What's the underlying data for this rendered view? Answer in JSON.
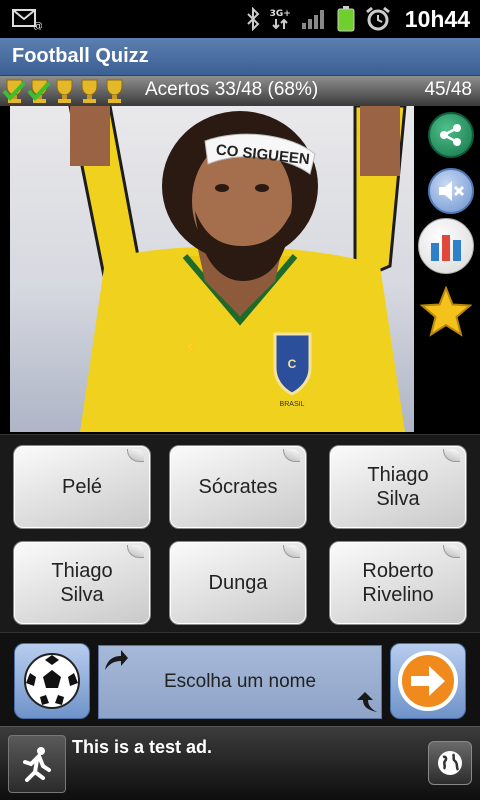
{
  "status_bar": {
    "time": "10h44",
    "network_label": "3G+",
    "icons": [
      "email-notification-icon",
      "bluetooth-icon",
      "network-3g-icon",
      "signal-icon",
      "battery-icon",
      "alarm-icon"
    ]
  },
  "app": {
    "title": "Football Quizz"
  },
  "score": {
    "trophies": [
      "checked-trophy",
      "checked-trophy",
      "trophy",
      "trophy",
      "trophy"
    ],
    "correct_text": "Acertos 33/48 (68%)",
    "progress_text": "45/48"
  },
  "photo": {
    "headband_text": "CO SIGUEEN",
    "jersey_text": "BRASIL"
  },
  "side_buttons": [
    "share-icon",
    "mute-icon",
    "stats-icon",
    "favorite-star-icon"
  ],
  "answers": [
    {
      "label": "Pelé"
    },
    {
      "label": "Sócrates"
    },
    {
      "label": "Thiago Silva"
    },
    {
      "label": "Thiago Silva"
    },
    {
      "label": "Dunga"
    },
    {
      "label": "Roberto Rivelino"
    }
  ],
  "controls": {
    "answer_field_text": "Escolha um nome"
  },
  "ad": {
    "text": "This is a test ad."
  },
  "colors": {
    "title_bar": "#4a6ea3",
    "share_green": "#15744a",
    "go_orange": "#f08a1c",
    "jersey_yellow": "#f0d21e"
  }
}
